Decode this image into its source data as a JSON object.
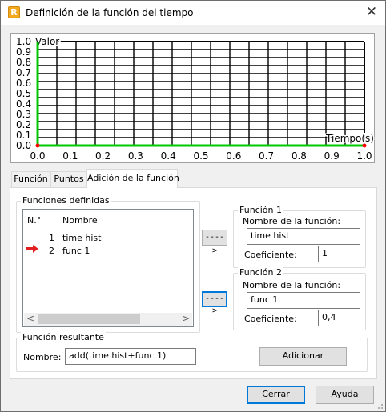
{
  "window": {
    "title": "Definición de la función del tiempo",
    "app_icon_glyph": "R",
    "close_glyph": "✕"
  },
  "chart_data": {
    "type": "line",
    "xlabel": "Tiempo(s)",
    "ylabel": "Valor",
    "xlim": [
      0.0,
      1.0
    ],
    "ylim": [
      0.0,
      1.0
    ],
    "x_tick_labels": [
      "0.0",
      "0.1",
      "0.2",
      "0.3",
      "0.4",
      "0.5",
      "0.6",
      "0.7",
      "0.8",
      "0.9",
      "1.0"
    ],
    "y_tick_labels": [
      "0.0",
      "0.1",
      "0.2",
      "0.3",
      "0.4",
      "0.5",
      "0.6",
      "0.7",
      "0.8",
      "0.9",
      "1.0"
    ],
    "grid": true,
    "series": [
      {
        "color": "#00c800",
        "x": [
          0.0,
          0.0,
          1.0
        ],
        "y": [
          1.0,
          0.0,
          0.0
        ]
      }
    ],
    "markers": [
      {
        "x": 0.0,
        "y": 0.0,
        "color": "#ff0000"
      },
      {
        "x": 1.0,
        "y": 0.0,
        "color": "#ff0000"
      }
    ]
  },
  "tabs": [
    {
      "label": "Función",
      "active": false
    },
    {
      "label": "Puntos",
      "active": false
    },
    {
      "label": "Adición de la función",
      "active": true
    }
  ],
  "defined_functions": {
    "legend": "Funciones definidas",
    "col_number": "N.°",
    "col_name": "Nombre",
    "rows": [
      {
        "number": "1",
        "name": "time hist",
        "marked": false
      },
      {
        "number": "2",
        "name": "func 1",
        "marked": true
      }
    ],
    "scroll_left": "<",
    "scroll_right": ">"
  },
  "arrow_button_label": "---->",
  "function1": {
    "legend": "Función 1",
    "name_label": "Nombre de la función:",
    "name_value": "time hist",
    "coef_label": "Coeficiente:",
    "coef_value": "1"
  },
  "function2": {
    "legend": "Función 2",
    "name_label": "Nombre de la función:",
    "name_value": "func 1",
    "coef_label": "Coeficiente:",
    "coef_value": "0,4"
  },
  "result": {
    "legend": "Función resultante",
    "name_label": "Nombre:",
    "name_value": "add(time hist+func 1)",
    "add_button": "Adicionar"
  },
  "buttons": {
    "close": "Cerrar",
    "help": "Ayuda"
  },
  "colors": {
    "series_line": "#00c800",
    "marker": "#ff0000",
    "arrow_icon": "#e02020",
    "focus": "#0078d7"
  }
}
